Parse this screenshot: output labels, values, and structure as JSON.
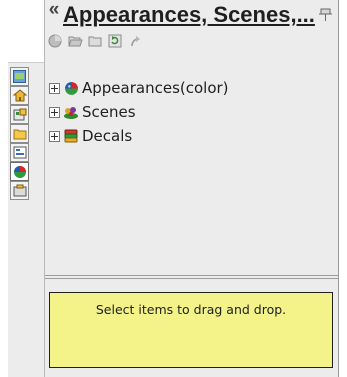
{
  "panel": {
    "collapse_glyph": "«",
    "title": "Appearances, Scenes,...",
    "pin_icon": "pin-icon"
  },
  "toolbar": {
    "icons": [
      "appearance-icon",
      "open-folder-icon",
      "new-folder-icon",
      "refresh-icon",
      "up-arrow-icon"
    ]
  },
  "left_tabs": [
    "feature-manager-icon",
    "home-icon",
    "property-manager-icon",
    "folder-icon",
    "configuration-manager-icon",
    "appearances-icon",
    "custom-properties-icon"
  ],
  "tree": {
    "items": [
      {
        "label": "Appearances(color)",
        "icon": "appearance-ball-icon"
      },
      {
        "label": "Scenes",
        "icon": "scene-icon"
      },
      {
        "label": "Decals",
        "icon": "decals-icon"
      }
    ]
  },
  "info": {
    "message": "Select items to drag and drop."
  },
  "colors": {
    "panel_bg": "#ececec",
    "info_bg": "#f3f38a",
    "title": "#1f1f1f"
  }
}
